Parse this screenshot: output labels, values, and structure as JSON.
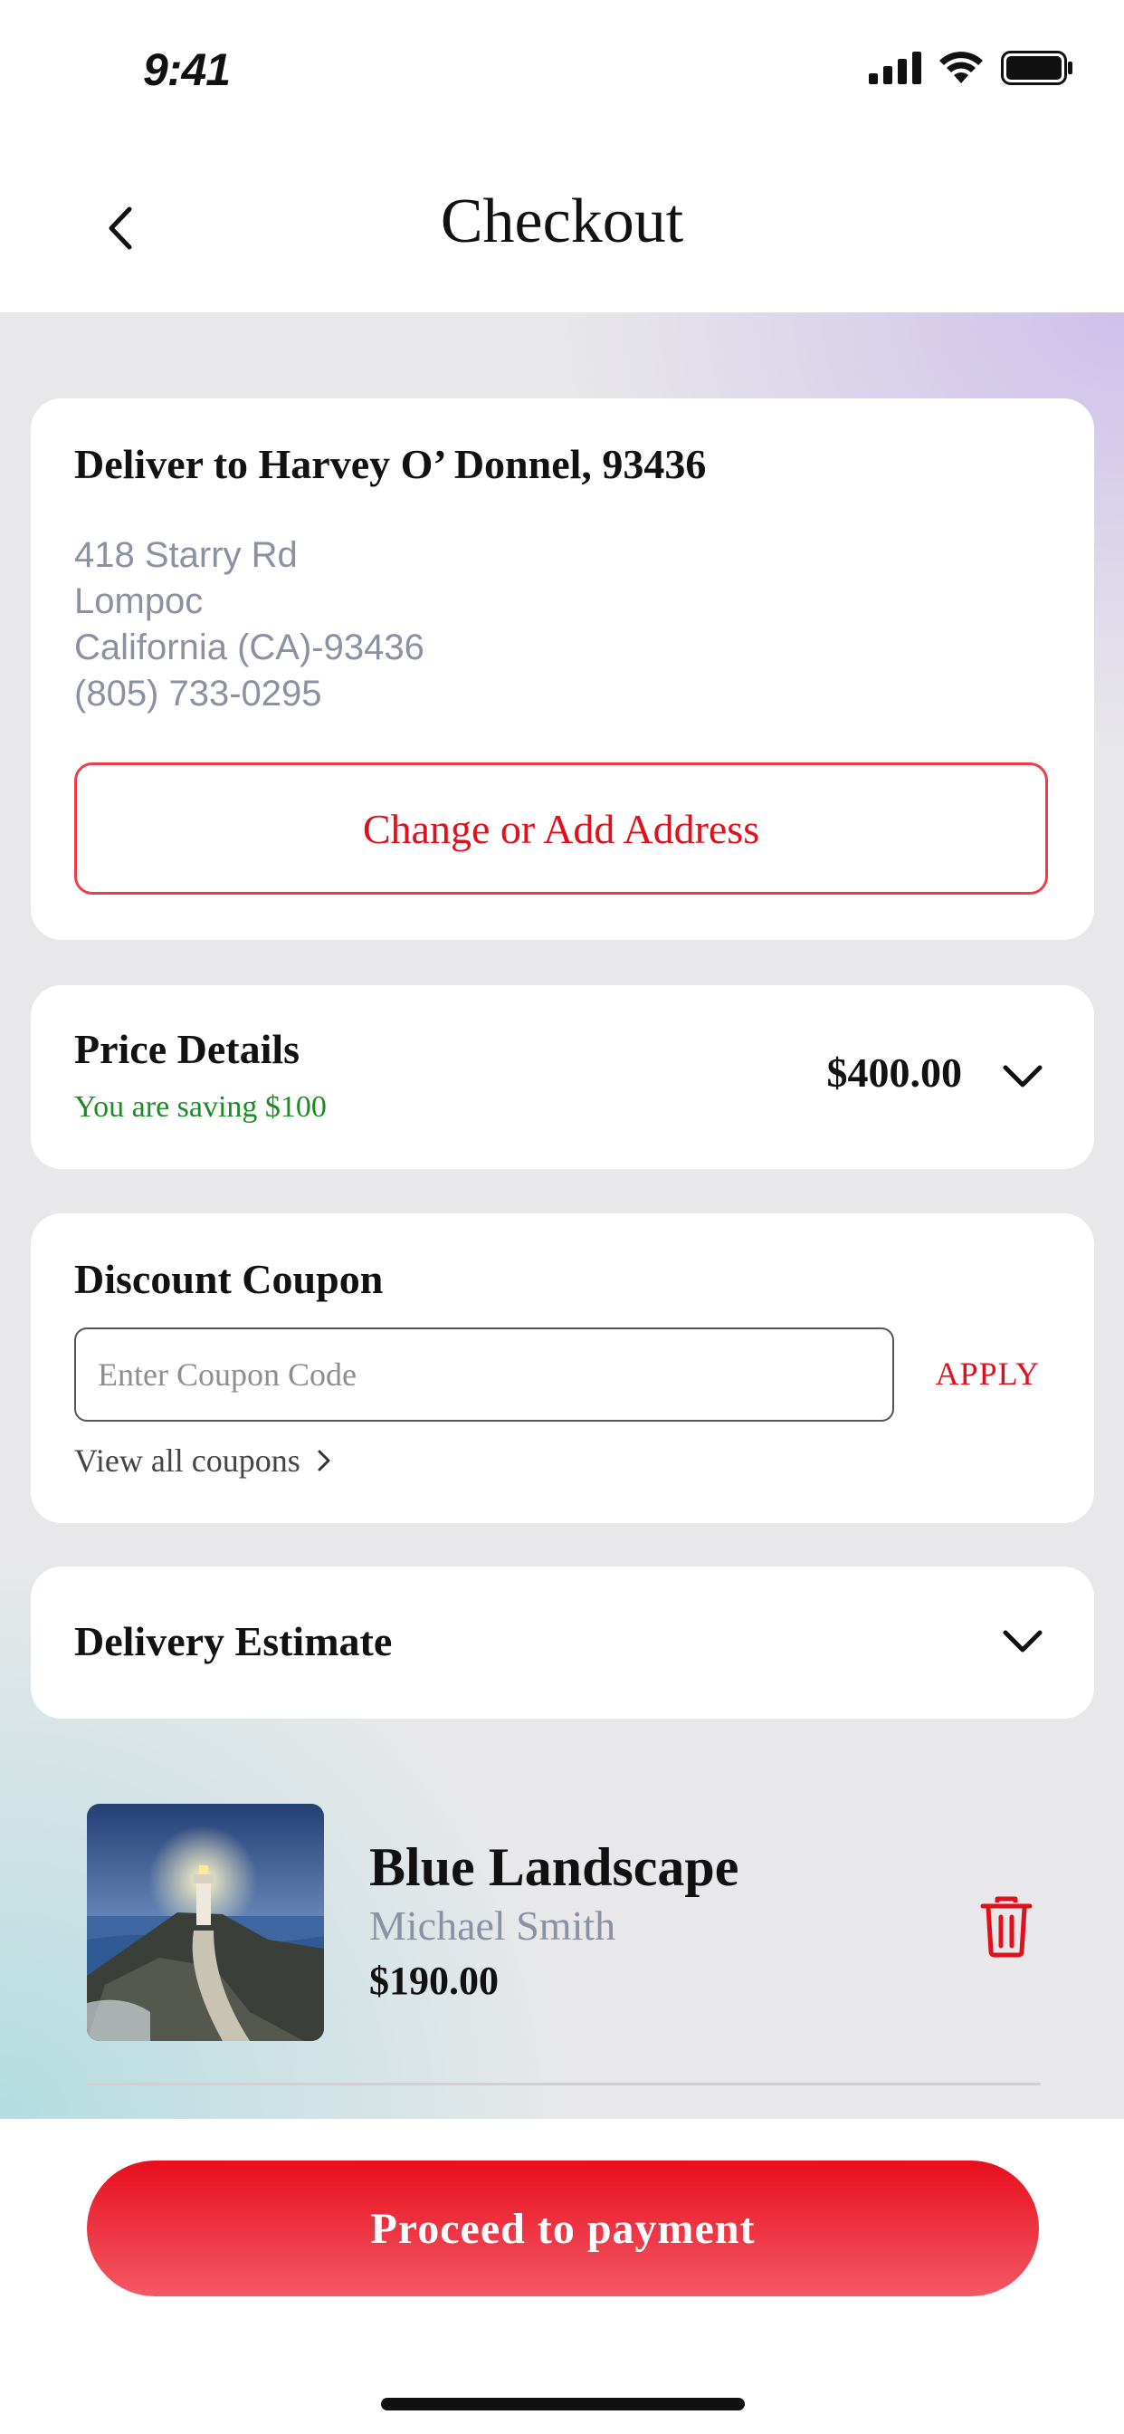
{
  "status_bar": {
    "time": "9:41"
  },
  "header": {
    "title": "Checkout"
  },
  "address": {
    "title": "Deliver to Harvey O’ Donnel, 93436",
    "lines": [
      "418 Starry Rd",
      "Lompoc",
      "California (CA)-93436",
      "(805) 733-0295"
    ],
    "change_label": "Change or Add Address"
  },
  "price_details": {
    "title": "Price Details",
    "saving": "You are saving $100",
    "total": "$400.00"
  },
  "coupon": {
    "title": "Discount Coupon",
    "placeholder": "Enter Coupon Code",
    "value": "",
    "apply_label": "APPLY",
    "view_all_label": "View all coupons"
  },
  "delivery": {
    "title": "Delivery Estimate"
  },
  "cart_item": {
    "name": "Blue Landscape",
    "artist": "Michael Smith",
    "price": "$190.00"
  },
  "footer": {
    "proceed_label": "Proceed to payment"
  },
  "colors": {
    "accent": "#e0101c",
    "saving_green": "#1d8a25",
    "muted_text": "#8a91a3"
  }
}
